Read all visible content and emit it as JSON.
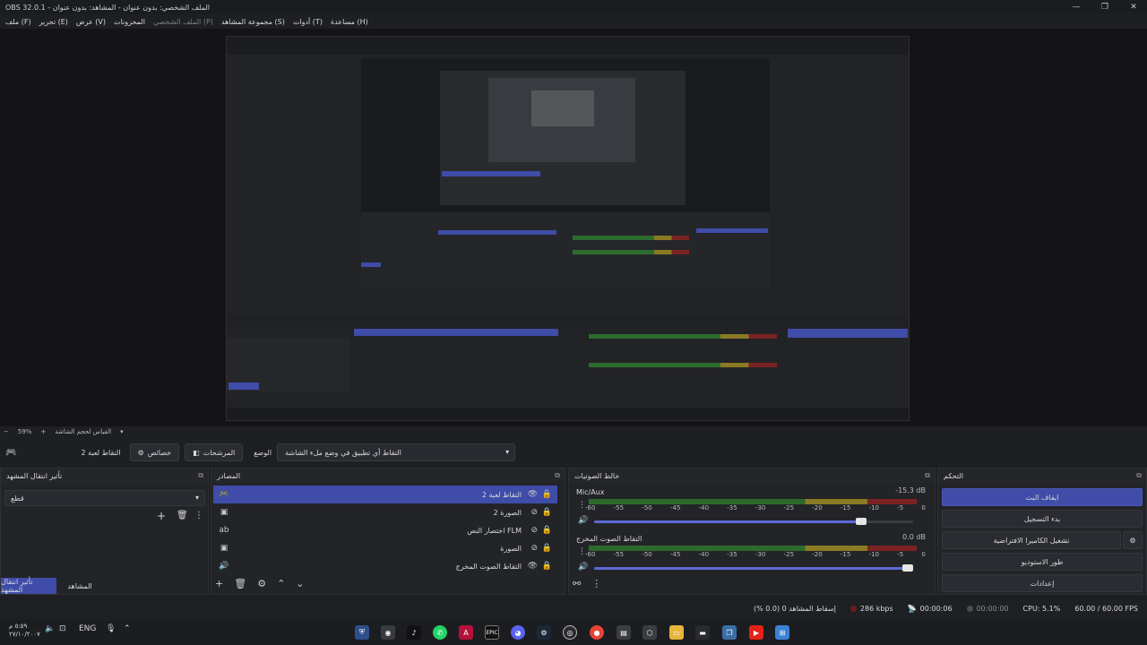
{
  "window": {
    "title": "OBS 32.0.1 - الملف الشخصي: بدون عنوان - المشاهد: بدون عنوان"
  },
  "menu": [
    {
      "label": "ملف (F)",
      "enabled": true
    },
    {
      "label": "تحرير (E)",
      "enabled": true
    },
    {
      "label": "عرض (V)",
      "enabled": true
    },
    {
      "label": "المحزونات",
      "enabled": true
    },
    {
      "label": "الملف الشخصي (P)",
      "enabled": false
    },
    {
      "label": "مجموعة المشاهد (S)",
      "enabled": true
    },
    {
      "label": "أدوات (T)",
      "enabled": true
    },
    {
      "label": "مساعدة (H)",
      "enabled": true
    }
  ],
  "preview_status": {
    "zoom": "59%",
    "label": "القياس لحجم الشاشة"
  },
  "scene_toolbar": {
    "source_name": "التقاط لعبة 2",
    "properties_label": "خصائص",
    "filters_label": "المرشحات",
    "mode_label": "الوضع",
    "mode_value": "التقاط أي تطبيق في وضع ملء الشاشة"
  },
  "transitions_dock": {
    "title": "تأثير انتقال المشهد",
    "selected": "قطع",
    "tab_transitions": "تأثير انتقال المشهد",
    "tab_scenes": "المشاهد"
  },
  "sources_dock": {
    "title": "المصادر",
    "items": [
      {
        "name": "التقاط لعبة 2",
        "icon": "gamepad-icon",
        "selected": true
      },
      {
        "name": "الصورة 2",
        "icon": "image-icon",
        "selected": false
      },
      {
        "name": "اختصار النص FLM",
        "icon": "text-icon",
        "selected": false
      },
      {
        "name": "الصورة",
        "icon": "image-icon",
        "selected": false
      },
      {
        "name": "التقاط الصوت المخرج",
        "icon": "speaker-icon",
        "selected": false
      }
    ]
  },
  "audio_mixer": {
    "title": "خالط الصوتيات",
    "scale": [
      "-60",
      "-55",
      "-50",
      "-45",
      "-40",
      "-35",
      "-30",
      "-25",
      "-20",
      "-15",
      "-10",
      "-5",
      "0"
    ],
    "channels": [
      {
        "name": "Mic/Aux",
        "db": "-15.3 dB",
        "level_fraction": 0.0,
        "volume_fraction": 0.82
      },
      {
        "name": "التقاط الصوت المخرج",
        "db": "0.0 dB",
        "level_fraction": 0.0,
        "volume_fraction": 1.0
      }
    ]
  },
  "controls_dock": {
    "title": "التحكم",
    "buttons": [
      {
        "label": "ايقاف البث",
        "primary": true
      },
      {
        "label": "بدء التسجيل",
        "primary": false
      },
      {
        "label": "تشغيل الكاميرا الافتراضية",
        "primary": false
      },
      {
        "label": "طور الاستوديو",
        "primary": false
      },
      {
        "label": "إعدادات",
        "primary": false
      }
    ]
  },
  "status_bar": {
    "dropped": "إسقاط المشاهد 0 (0.0 %)",
    "bitrate": "286 kbps",
    "stream_time": "00:00:06",
    "rec_time": "00:00:00",
    "cpu": "CPU: 5.1%",
    "fps": "60.00 / 60.00 FPS"
  },
  "taskbar": {
    "clock_time": "٥:٥٩ م",
    "clock_date": "٢٧/١٠/٢٠٠٧",
    "lang": "ENG",
    "colors": {
      "chrome": "#ea4335",
      "steam": "#1b2838",
      "whatsapp": "#25d366",
      "youtube": "#e62117"
    }
  }
}
